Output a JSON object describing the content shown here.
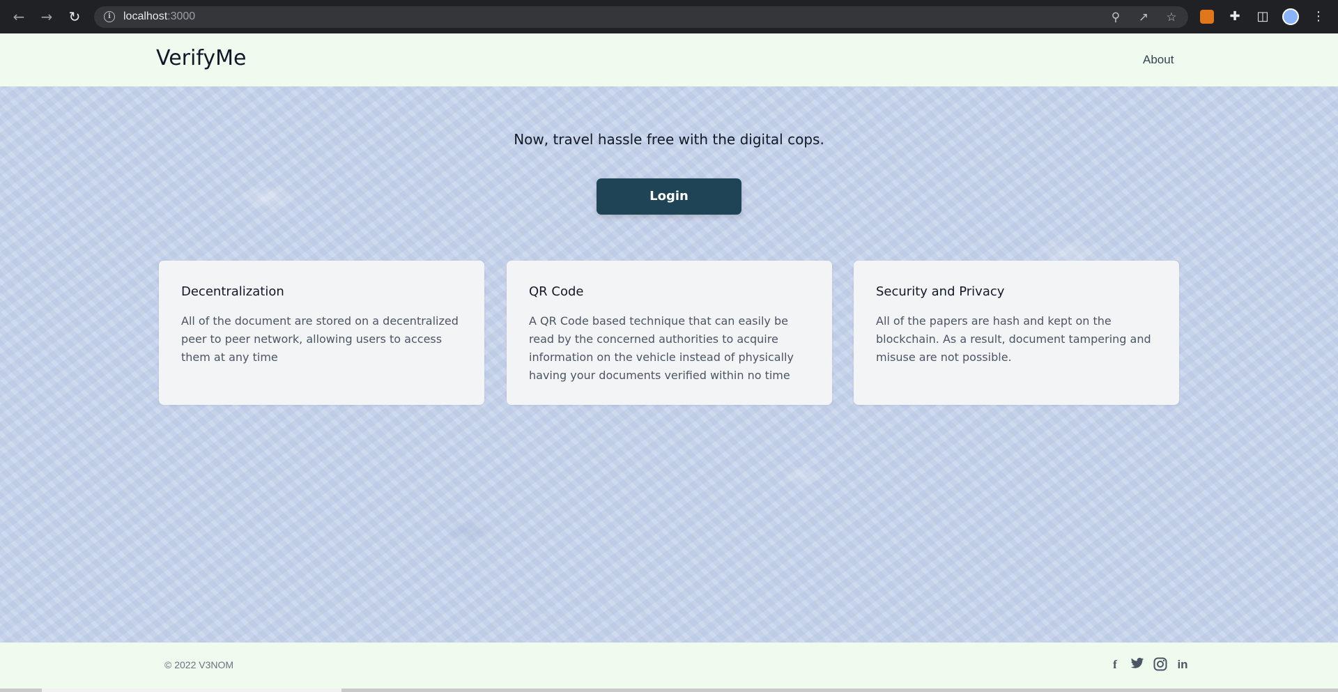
{
  "browser": {
    "url_host": "localhost",
    "url_port": ":3000",
    "icons": {
      "back": "back-arrow-icon",
      "forward": "forward-arrow-icon",
      "reload": "reload-icon",
      "info": "info-icon",
      "zoom": "zoom-icon",
      "share": "share-icon",
      "bookmark": "star-icon",
      "metamask": "fox-extension-icon",
      "extensions": "puzzle-icon",
      "side_panel": "side-panel-icon",
      "profile": "avatar-icon",
      "menu": "kebab-menu-icon"
    }
  },
  "header": {
    "brand": "VerifyMe",
    "nav_about": "About"
  },
  "hero": {
    "tagline": "Now, travel hassle free with the digital cops.",
    "login_label": "Login"
  },
  "features": [
    {
      "title": "Decentralization",
      "text": "All of the document are stored on a decentralized peer to peer network, allowing users to access them at any time"
    },
    {
      "title": "QR Code",
      "text": "A QR Code based technique that can easily be read by the concerned authorities to acquire information on the vehicle instead of physically having your documents verified within no time"
    },
    {
      "title": "Security and Privacy",
      "text": "All of the papers are hash and kept on the blockchain. As a result, document tampering and misuse are not possible."
    }
  ],
  "footer": {
    "copyright": "© 2022 V3NOM",
    "social": [
      "facebook-icon",
      "twitter-icon",
      "instagram-icon",
      "linkedin-icon"
    ]
  },
  "colors": {
    "header_bg": "#eefbee",
    "login_bg": "#1f4456",
    "card_bg": "#f3f4f6"
  }
}
